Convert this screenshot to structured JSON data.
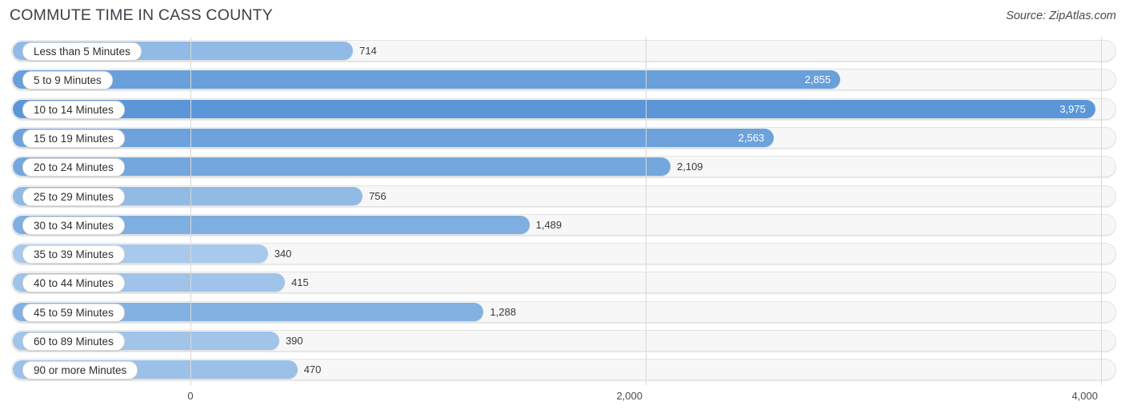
{
  "header": {
    "title": "COMMUTE TIME IN CASS COUNTY",
    "source": "Source: ZipAtlas.com"
  },
  "colors": {
    "bar_min": "#a8c9eb",
    "bar_max": "#5b96d8",
    "track_bg": "#f7f7f7",
    "track_border": "#e4e4e4",
    "gridline": "#d8d8d8",
    "value_inside": "#ffffff",
    "value_outside": "#3a3a3a",
    "title": "#3b3f46"
  },
  "chart_data": {
    "type": "bar",
    "orientation": "horizontal",
    "title": "COMMUTE TIME IN CASS COUNTY",
    "xlabel": "",
    "ylabel": "",
    "xlim": [
      0,
      4860
    ],
    "grid": true,
    "legend": false,
    "xticks": [
      0,
      2000,
      4000
    ],
    "xtick_labels": [
      "0",
      "2,000",
      "4,000"
    ],
    "categories": [
      "Less than 5 Minutes",
      "5 to 9 Minutes",
      "10 to 14 Minutes",
      "15 to 19 Minutes",
      "20 to 24 Minutes",
      "25 to 29 Minutes",
      "30 to 34 Minutes",
      "35 to 39 Minutes",
      "40 to 44 Minutes",
      "45 to 59 Minutes",
      "60 to 89 Minutes",
      "90 or more Minutes"
    ],
    "values": [
      714,
      2855,
      3975,
      2563,
      2109,
      756,
      1489,
      340,
      415,
      1288,
      390,
      470
    ],
    "value_labels": [
      "714",
      "2,855",
      "3,975",
      "2,563",
      "2,109",
      "756",
      "1,489",
      "340",
      "415",
      "1,288",
      "390",
      "470"
    ],
    "label_placement": [
      "outside",
      "inside",
      "inside",
      "inside",
      "outside",
      "outside",
      "outside",
      "outside",
      "outside",
      "outside",
      "outside",
      "outside"
    ]
  }
}
